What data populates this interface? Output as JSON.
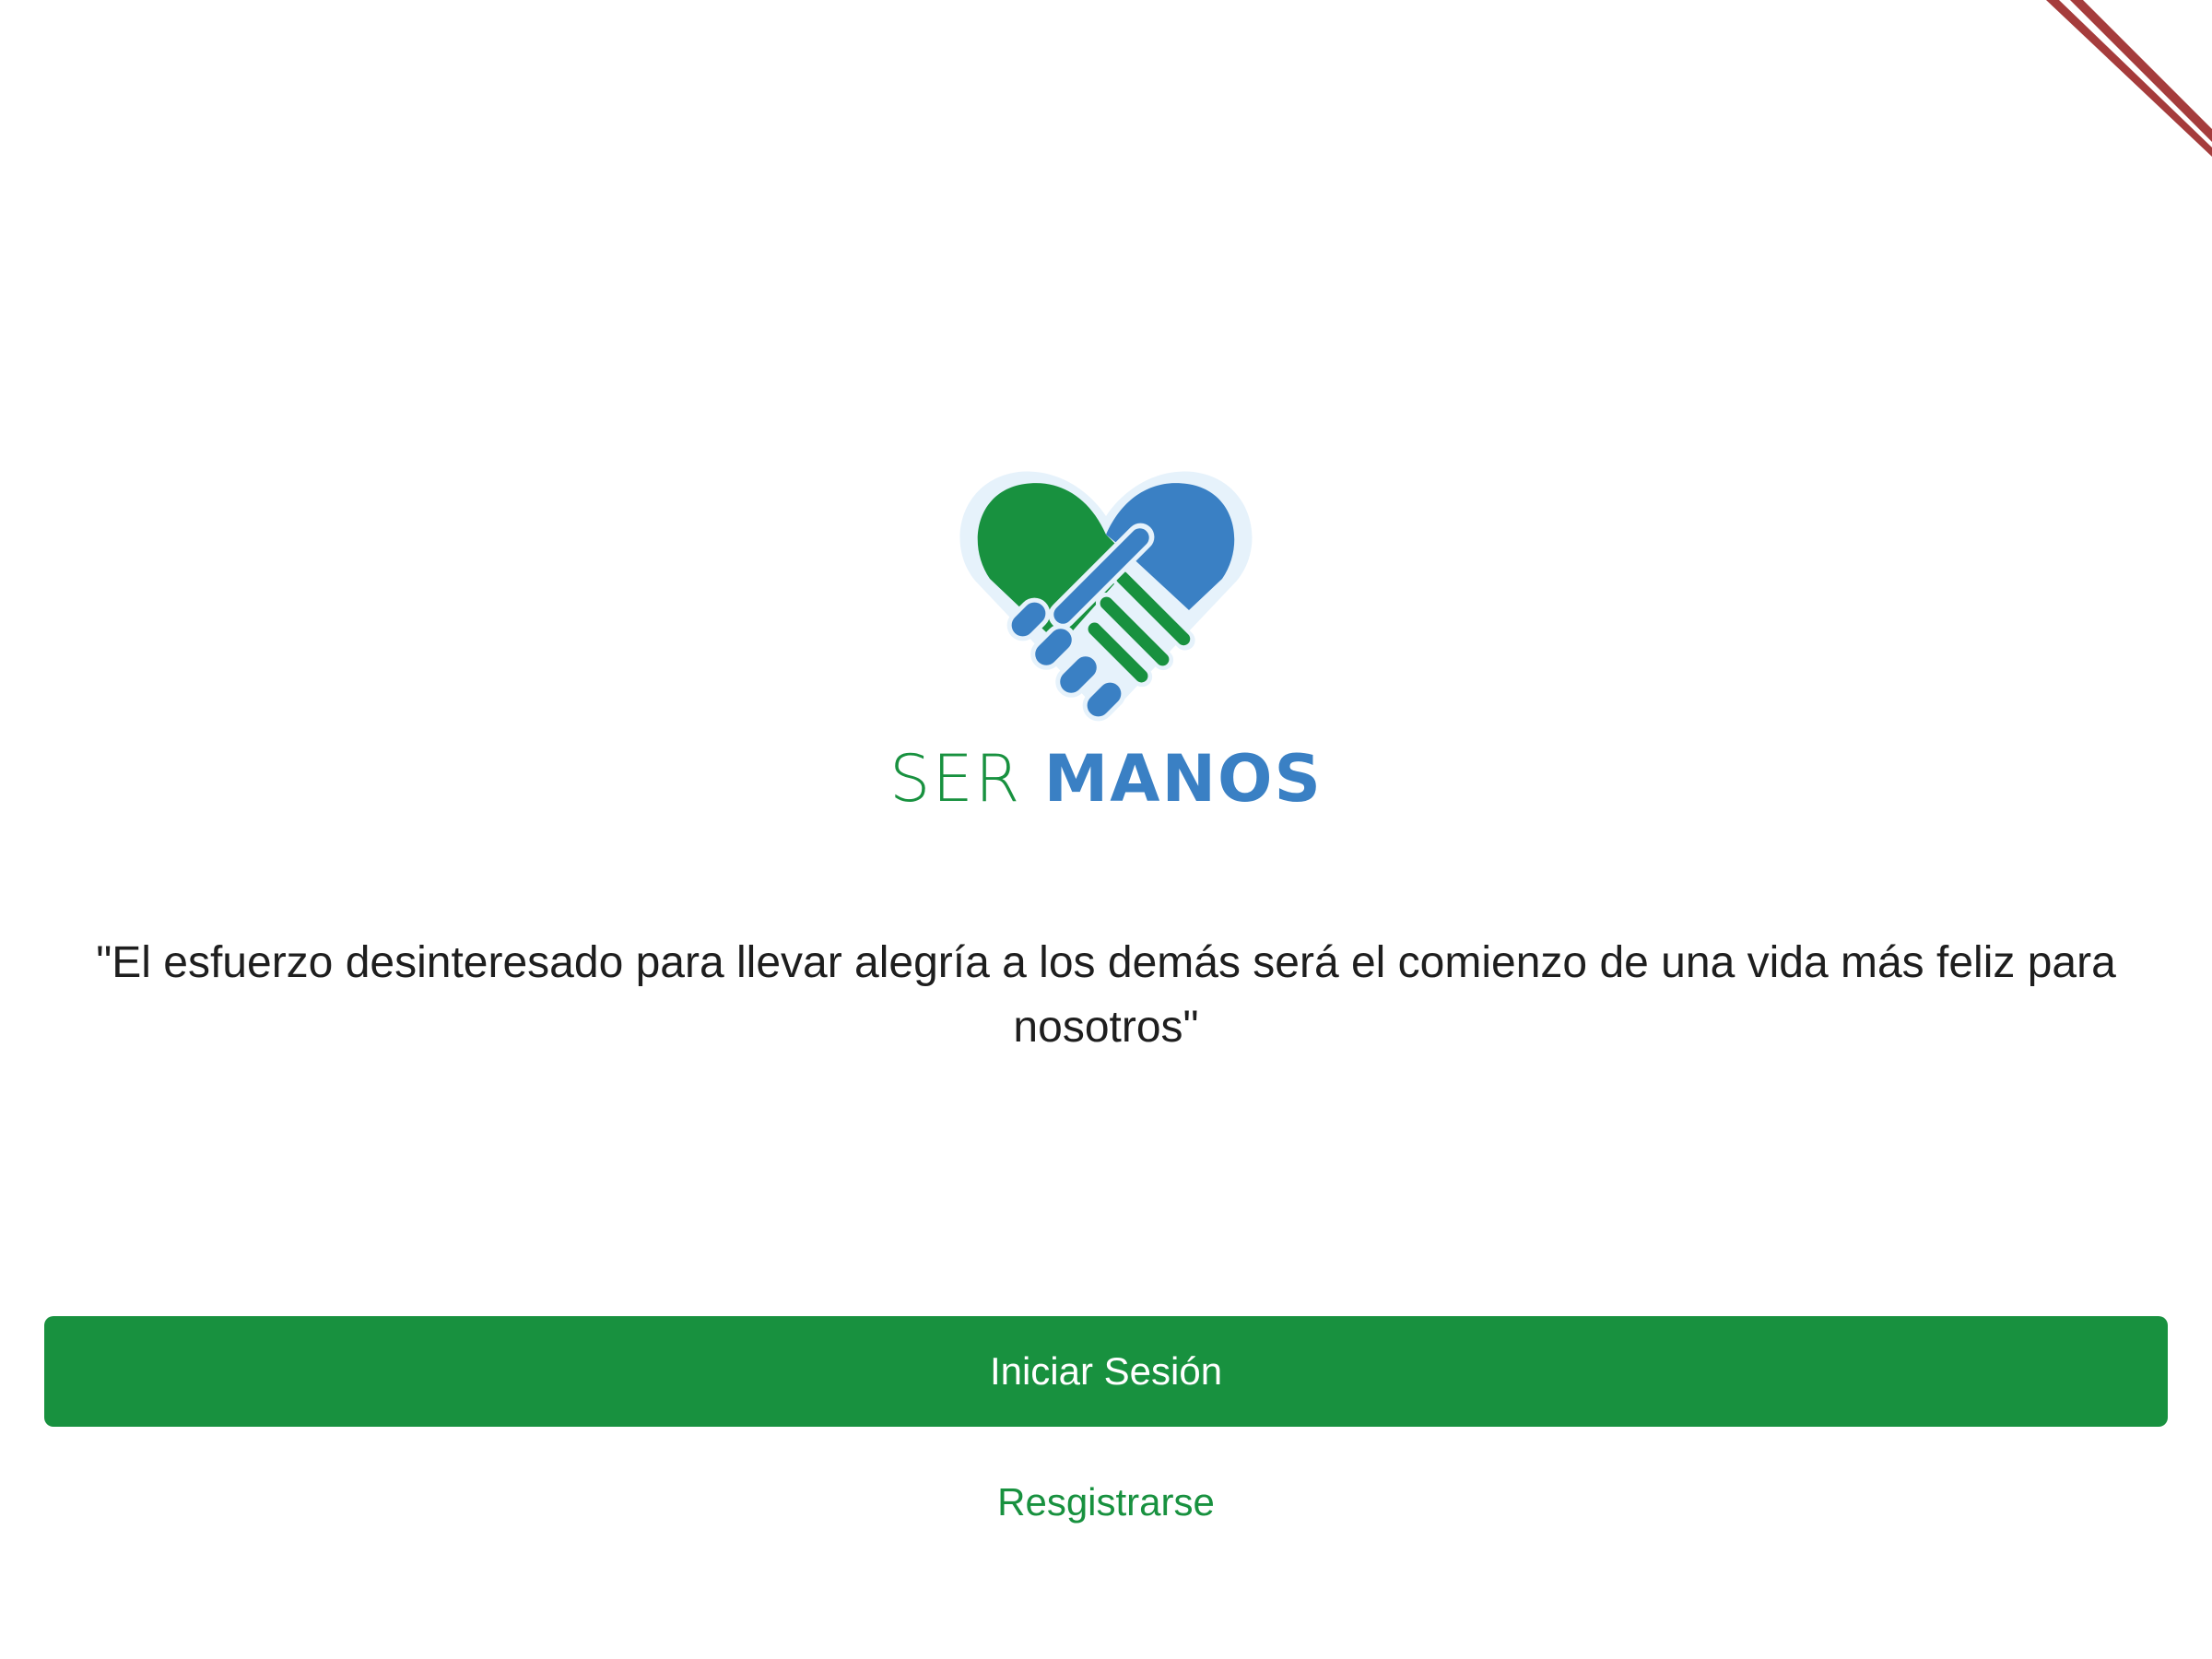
{
  "app": {
    "brand_part1": "SER",
    "brand_part2": "MANOS",
    "logo_icon": "heart-handshake-icon"
  },
  "quote": {
    "text": "\"El esfuerzo desinteresado para llevar alegría a los demás será el comienzo de una vida más feliz para nosotros\""
  },
  "actions": {
    "login_label": "Iniciar Sesión",
    "register_label": "Resgistrarse"
  },
  "colors": {
    "primary_green": "#18913f",
    "primary_blue": "#3a80c4",
    "text": "#1e1e1e",
    "background": "#ffffff",
    "debug_banner": "#a53c3c"
  }
}
